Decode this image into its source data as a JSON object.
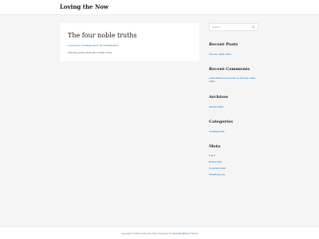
{
  "header": {
    "site_title": "Loving the Now"
  },
  "post": {
    "title": "The four noble truths",
    "meta": {
      "comments": "1 Comment",
      "sep1": " / ",
      "category": "Uncategorized",
      "sep2": " / By ",
      "author": "michellemazur"
    },
    "excerpt": "This blog post is about the 4 Noble Truths"
  },
  "sidebar": {
    "search": {
      "placeholder": "Search …"
    },
    "recent_posts": {
      "title": "Recent Posts",
      "items": [
        "The four noble truths"
      ]
    },
    "recent_comments": {
      "title": "Recent Comments",
      "text": "A WordPress Commenter on The four noble truths"
    },
    "archives": {
      "title": "Archives",
      "items": [
        "January 2021"
      ]
    },
    "categories": {
      "title": "Categories",
      "items": [
        "Uncategorized"
      ]
    },
    "meta": {
      "title": "Meta",
      "items": [
        "Log in",
        "Entries feed",
        "Comments feed",
        "WordPress.org"
      ]
    }
  },
  "footer": {
    "prefix": "Copyright © 2022 Loving the Now | Powered by ",
    "link": "Astra WordPress Theme"
  }
}
